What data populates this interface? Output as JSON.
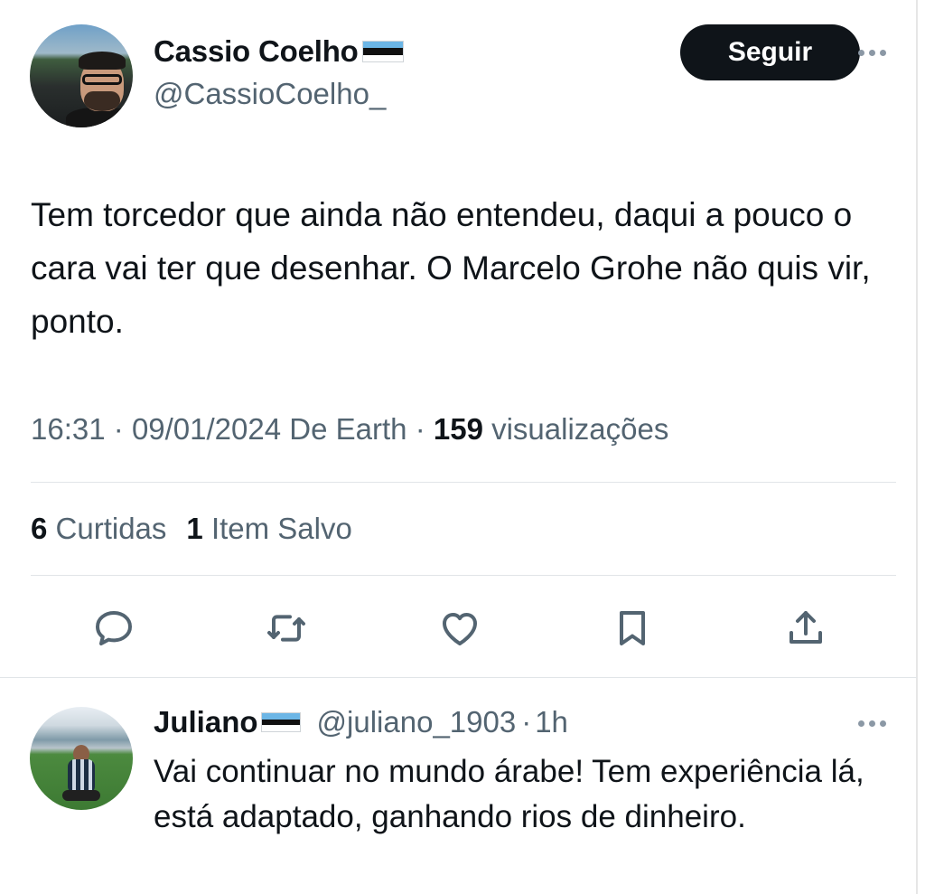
{
  "tweet": {
    "author_name": "Cassio Coelho",
    "author_handle": "@CassioCoelho_",
    "follow_label": "Seguir",
    "text": "Tem torcedor que ainda não entendeu, daqui a pouco o cara vai ter que desenhar. O Marcelo Grohe não quis vir, ponto.",
    "time": "16:31",
    "date": "09/01/2024",
    "source": "De Earth",
    "separator": "·",
    "views_count": "159",
    "views_label": "visualizações",
    "likes_count": "6",
    "likes_label": "Curtidas",
    "bookmarks_count": "1",
    "bookmarks_label": "Item Salvo"
  },
  "actions": [
    {
      "icon": "reply-icon"
    },
    {
      "icon": "retweet-icon"
    },
    {
      "icon": "like-icon"
    },
    {
      "icon": "bookmark-icon"
    },
    {
      "icon": "share-icon"
    }
  ],
  "reply": {
    "author_name": "Juliano",
    "author_handle": "@juliano_1903",
    "separator": "·",
    "time": "1h",
    "text": "Vai continuar no mundo árabe! Tem experiência lá, está adaptado, ganhando rios de dinheiro."
  },
  "colors": {
    "text_primary": "#0f1419",
    "text_secondary": "#536471",
    "follow_button_bg": "#0f1419",
    "flag_blue": "#6cb6e6",
    "flag_black": "#111111",
    "flag_white": "#ffffff"
  }
}
